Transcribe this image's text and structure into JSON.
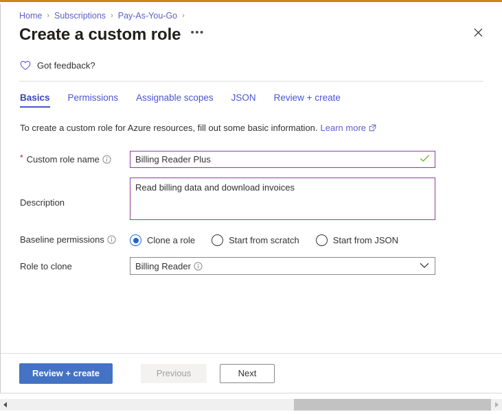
{
  "breadcrumb": {
    "items": [
      {
        "label": "Home"
      },
      {
        "label": "Subscriptions"
      },
      {
        "label": "Pay-As-You-Go"
      }
    ],
    "separator": "›"
  },
  "header": {
    "title": "Create a custom role",
    "ellipsis": "•••",
    "close_label": "Close"
  },
  "feedback": {
    "label": "Got feedback?",
    "icon": "heart-icon"
  },
  "tabs": [
    {
      "label": "Basics",
      "active": true
    },
    {
      "label": "Permissions",
      "active": false
    },
    {
      "label": "Assignable scopes",
      "active": false
    },
    {
      "label": "JSON",
      "active": false
    },
    {
      "label": "Review + create",
      "active": false
    }
  ],
  "intro": {
    "text": "To create a custom role for Azure resources, fill out some basic information.",
    "link_label": "Learn more",
    "link_icon": "external-link-icon"
  },
  "form": {
    "role_name": {
      "label": "Custom role name",
      "required_marker": "*",
      "info_icon": "info-icon",
      "value": "Billing Reader Plus",
      "placeholder": "",
      "valid_icon": "checkmark-icon"
    },
    "description": {
      "label": "Description",
      "value": "Read billing data and download invoices",
      "placeholder": ""
    },
    "baseline_permissions": {
      "label": "Baseline permissions",
      "info_icon": "info-icon",
      "options": [
        {
          "label": "Clone a role",
          "selected": true
        },
        {
          "label": "Start from scratch",
          "selected": false
        },
        {
          "label": "Start from JSON",
          "selected": false
        }
      ]
    },
    "role_to_clone": {
      "label": "Role to clone",
      "value": "Billing Reader",
      "info_icon": "info-icon",
      "chevron_icon": "chevron-down-icon"
    }
  },
  "footer": {
    "review_create": "Review + create",
    "previous": "Previous",
    "next": "Next"
  },
  "colors": {
    "accent_top_border": "#cc8419",
    "primary_button": "#4472c4",
    "link": "#5b5fc7",
    "tab_active": "#4a54cf",
    "input_border_focus": "#8a3ca0",
    "valid_check": "#7cb342",
    "required_star": "#a4262c"
  }
}
